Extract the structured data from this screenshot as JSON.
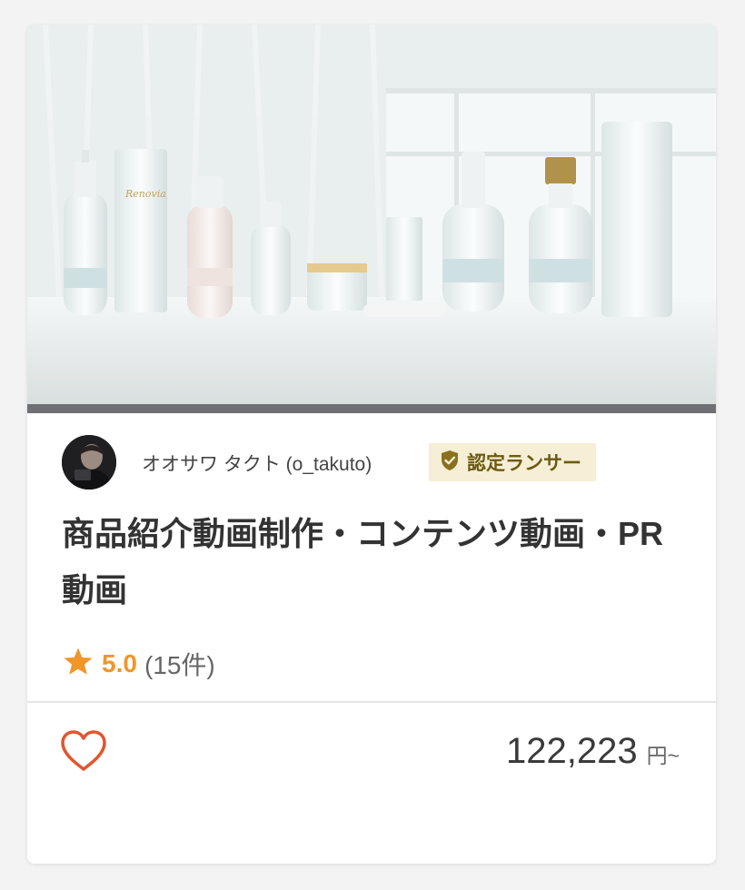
{
  "service": {
    "image_label": "Renovia",
    "seller": {
      "name": "オオサワ タクト (o_takuto)",
      "badge": "認定ランサー"
    },
    "title": "商品紹介動画制作・コンテンツ動画・PR動画",
    "rating": {
      "score": "5.0",
      "count": "(15件)"
    },
    "price": {
      "amount": "122,223",
      "unit": "円~"
    }
  },
  "icons": {
    "badge": "shield-check-icon",
    "star": "star-icon",
    "favorite": "heart-outline-icon"
  },
  "colors": {
    "rating": "#f0962a",
    "badge_bg": "#f6efd6",
    "badge_text": "#6b5a14",
    "favorite": "#e0562f"
  }
}
